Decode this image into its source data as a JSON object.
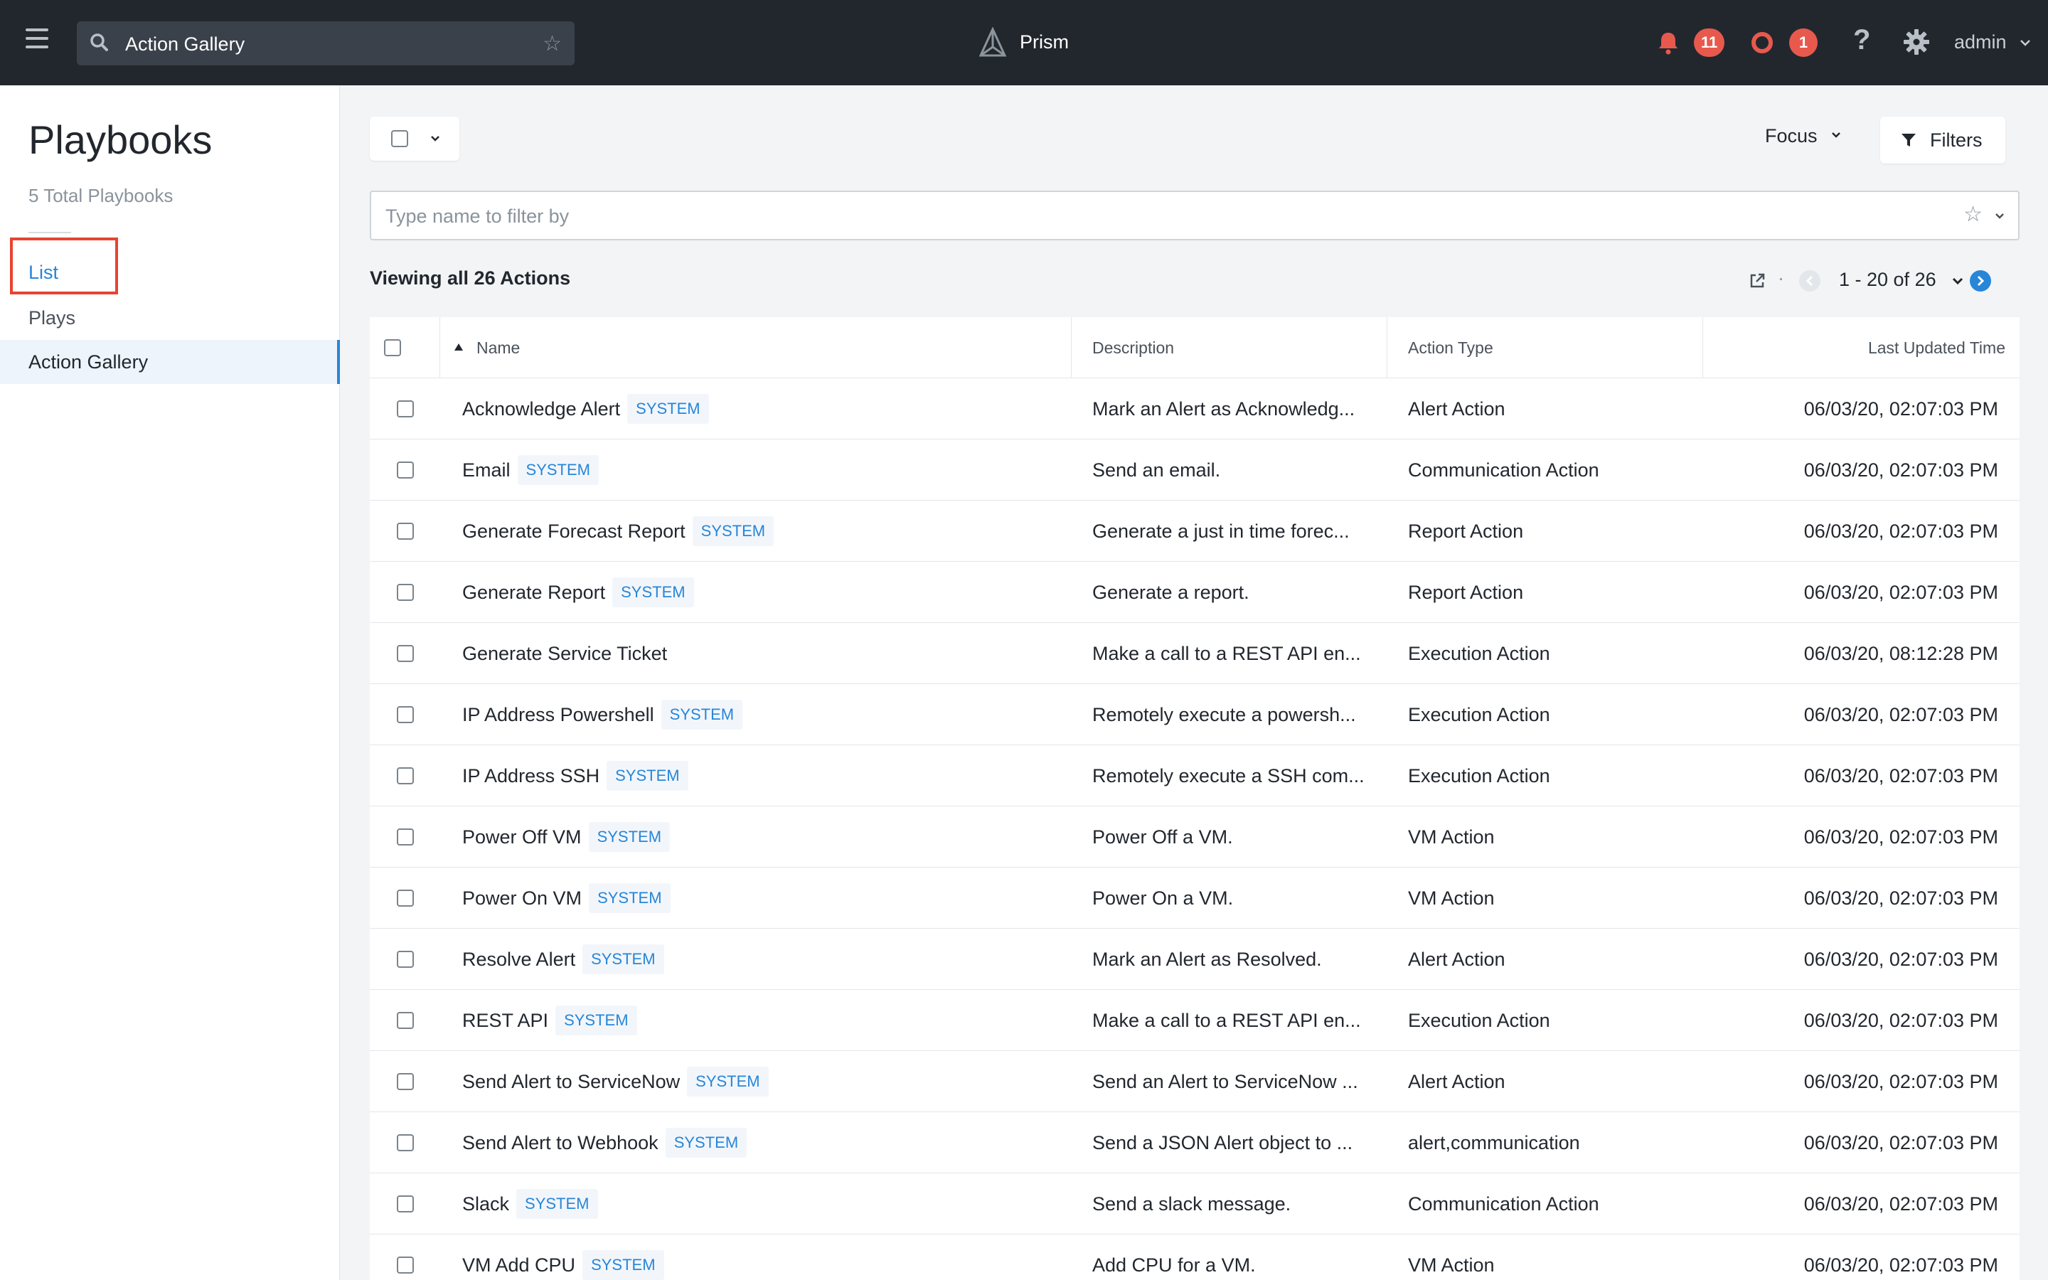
{
  "topbar": {
    "search_text": "Action Gallery",
    "brand": "Prism",
    "alerts_count": "11",
    "events_count": "1",
    "help": "?",
    "user": "admin"
  },
  "sidebar": {
    "title": "Playbooks",
    "count": "5 Total Playbooks",
    "items": [
      {
        "label": "List"
      },
      {
        "label": "Plays"
      },
      {
        "label": "Action Gallery"
      }
    ]
  },
  "toolbar": {
    "focus_label": "Focus",
    "filters_label": "Filters",
    "filter_placeholder": "Type name to filter by",
    "viewing_text": "Viewing all 26 Actions",
    "pager_dot": "·",
    "pager_range": "1 - 20 of 26"
  },
  "table": {
    "columns": [
      "Name",
      "Description",
      "Action Type",
      "Last Updated Time"
    ],
    "rows": [
      {
        "name": "Acknowledge Alert",
        "tag": "SYSTEM",
        "description": "Mark an Alert as Acknowledg...",
        "type": "Alert Action",
        "time": "06/03/20, 02:07:03 PM"
      },
      {
        "name": "Email",
        "tag": "SYSTEM",
        "description": "Send an email.",
        "type": "Communication Action",
        "time": "06/03/20, 02:07:03 PM"
      },
      {
        "name": "Generate Forecast Report",
        "tag": "SYSTEM",
        "description": "Generate a just in time forec...",
        "type": "Report Action",
        "time": "06/03/20, 02:07:03 PM"
      },
      {
        "name": "Generate Report",
        "tag": "SYSTEM",
        "description": "Generate a report.",
        "type": "Report Action",
        "time": "06/03/20, 02:07:03 PM"
      },
      {
        "name": "Generate Service Ticket",
        "tag": "",
        "description": "Make a call to a REST API en...",
        "type": "Execution Action",
        "time": "06/03/20, 08:12:28 PM"
      },
      {
        "name": "IP Address Powershell",
        "tag": "SYSTEM",
        "description": "Remotely execute a powersh...",
        "type": "Execution Action",
        "time": "06/03/20, 02:07:03 PM"
      },
      {
        "name": "IP Address SSH",
        "tag": "SYSTEM",
        "description": "Remotely execute a SSH com...",
        "type": "Execution Action",
        "time": "06/03/20, 02:07:03 PM"
      },
      {
        "name": "Power Off VM",
        "tag": "SYSTEM",
        "description": "Power Off a VM.",
        "type": "VM Action",
        "time": "06/03/20, 02:07:03 PM"
      },
      {
        "name": "Power On VM",
        "tag": "SYSTEM",
        "description": "Power On a VM.",
        "type": "VM Action",
        "time": "06/03/20, 02:07:03 PM"
      },
      {
        "name": "Resolve Alert",
        "tag": "SYSTEM",
        "description": "Mark an Alert as Resolved.",
        "type": "Alert Action",
        "time": "06/03/20, 02:07:03 PM"
      },
      {
        "name": "REST API",
        "tag": "SYSTEM",
        "description": "Make a call to a REST API en...",
        "type": "Execution Action",
        "time": "06/03/20, 02:07:03 PM"
      },
      {
        "name": "Send Alert to ServiceNow",
        "tag": "SYSTEM",
        "description": "Send an Alert to ServiceNow ...",
        "type": "Alert Action",
        "time": "06/03/20, 02:07:03 PM"
      },
      {
        "name": "Send Alert to Webhook",
        "tag": "SYSTEM",
        "description": "Send a JSON Alert object to ...",
        "type": "alert,communication",
        "time": "06/03/20, 02:07:03 PM"
      },
      {
        "name": "Slack",
        "tag": "SYSTEM",
        "description": "Send a slack message.",
        "type": "Communication Action",
        "time": "06/03/20, 02:07:03 PM"
      },
      {
        "name": "VM Add CPU",
        "tag": "SYSTEM",
        "description": "Add CPU for a VM.",
        "type": "VM Action",
        "time": "06/03/20, 02:07:03 PM"
      }
    ]
  },
  "icons": {
    "menu": "hamburger-icon",
    "search": "search-icon",
    "favorite": "star-icon",
    "brand": "prism-logo-icon",
    "alerts": "bell-icon",
    "events": "ring-icon",
    "settings": "gear-icon",
    "filter": "funnel-icon",
    "export": "external-link-icon"
  },
  "colors": {
    "accent": "#2786d8",
    "badge": "#e8594d",
    "topbar": "#22272e",
    "highlight": "#e8442f"
  }
}
